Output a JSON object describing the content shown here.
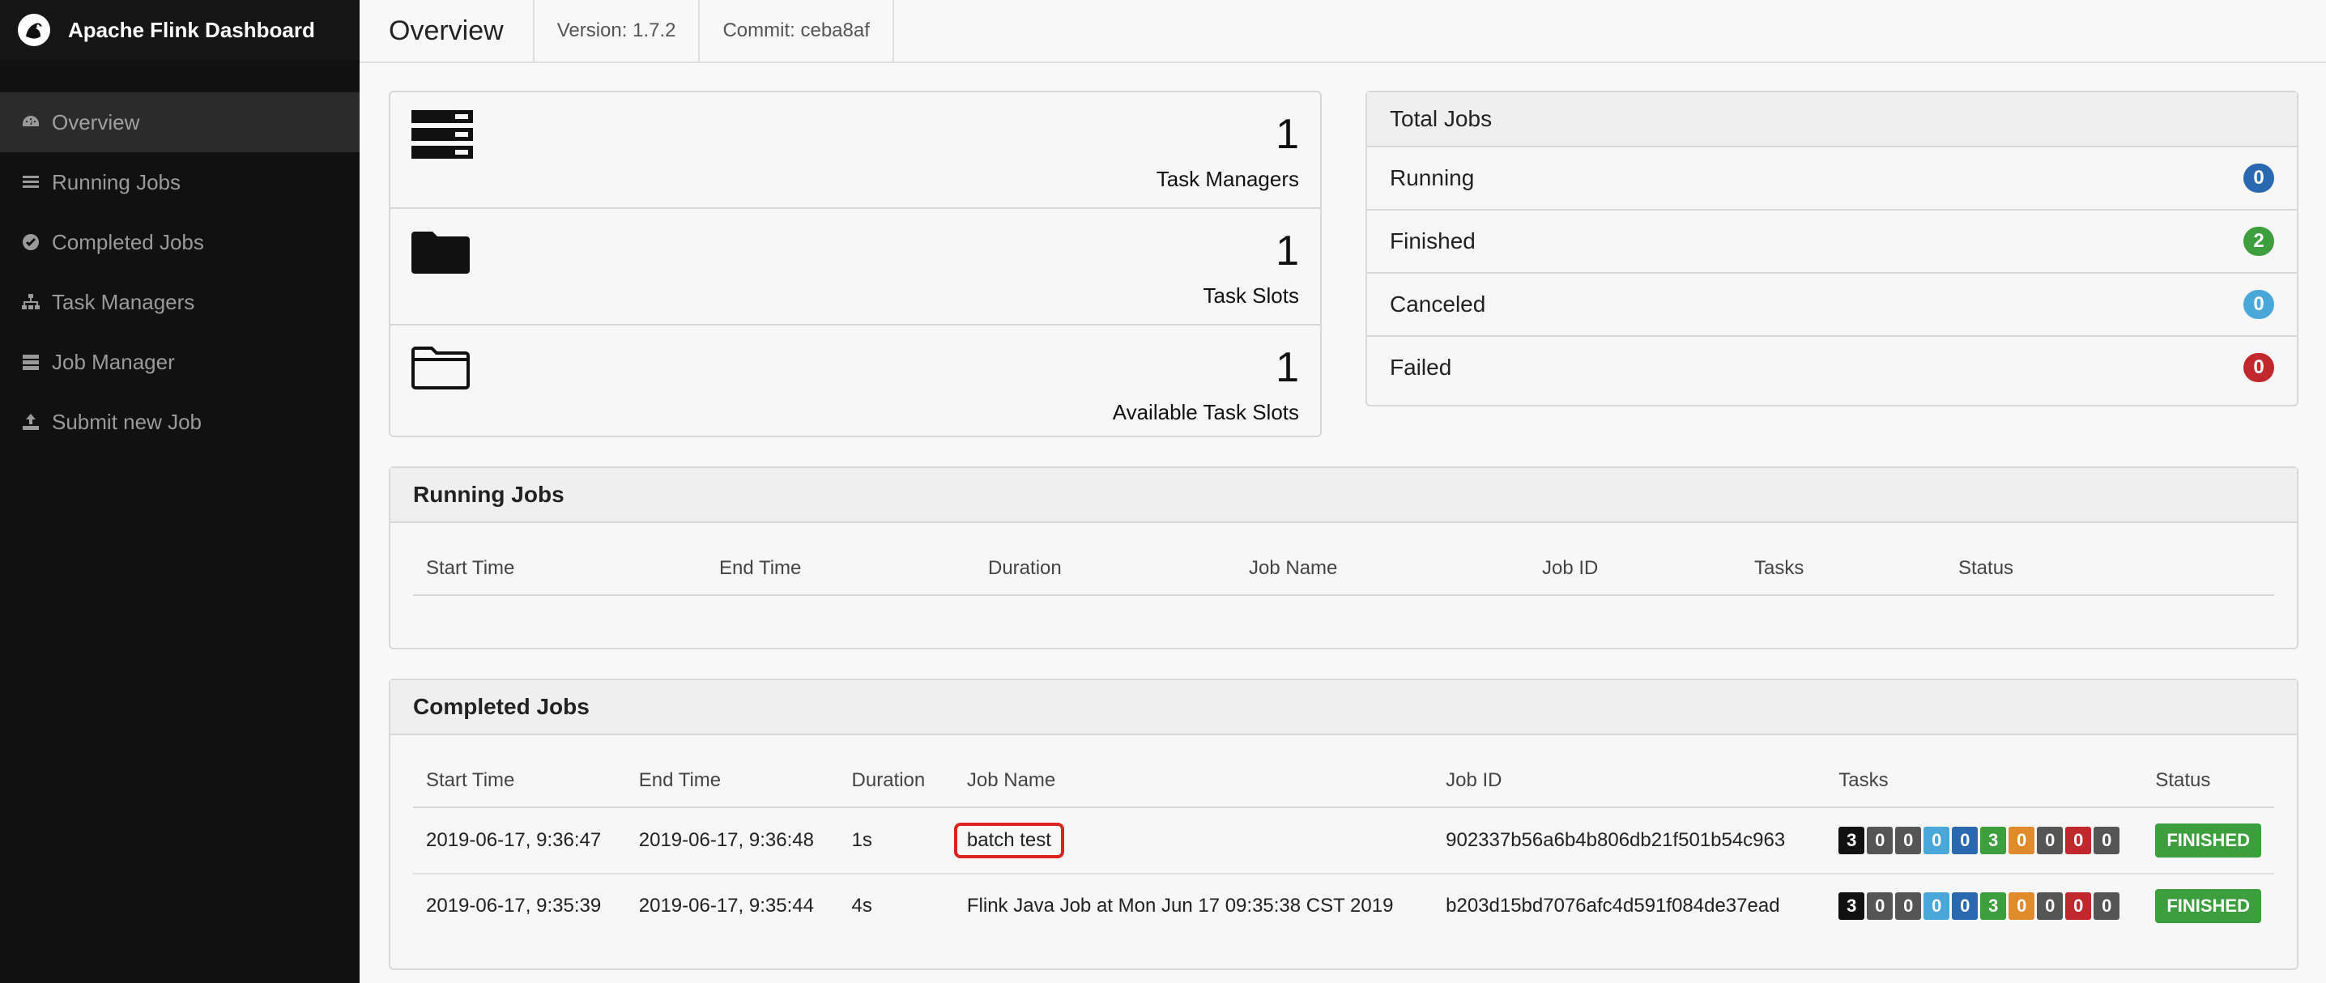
{
  "brand": {
    "title": "Apache Flink Dashboard"
  },
  "nav": [
    {
      "label": "Overview",
      "icon": "dashboard-icon",
      "active": true
    },
    {
      "label": "Running Jobs",
      "icon": "tasks-list-icon"
    },
    {
      "label": "Completed Jobs",
      "icon": "check-circle-icon"
    },
    {
      "label": "Task Managers",
      "icon": "sitemap-icon"
    },
    {
      "label": "Job Manager",
      "icon": "server-icon"
    },
    {
      "label": "Submit new Job",
      "icon": "upload-icon"
    }
  ],
  "header": {
    "title": "Overview",
    "version": "Version: 1.7.2",
    "commit": "Commit: ceba8af"
  },
  "stats": [
    {
      "value": "1",
      "label": "Task Managers",
      "icon": "server-stack-icon"
    },
    {
      "value": "1",
      "label": "Task Slots",
      "icon": "folder-icon"
    },
    {
      "value": "1",
      "label": "Available Task Slots",
      "icon": "folder-open-icon"
    }
  ],
  "totals": {
    "title": "Total Jobs",
    "rows": [
      {
        "label": "Running",
        "count": "0",
        "color": "#2a69b0"
      },
      {
        "label": "Finished",
        "count": "2",
        "color": "#3c9e3c"
      },
      {
        "label": "Canceled",
        "count": "0",
        "color": "#4aa8d8"
      },
      {
        "label": "Failed",
        "count": "0",
        "color": "#c0282d"
      }
    ]
  },
  "running": {
    "title": "Running Jobs",
    "columns": [
      "Start Time",
      "End Time",
      "Duration",
      "Job Name",
      "Job ID",
      "Tasks",
      "Status"
    ]
  },
  "completed": {
    "title": "Completed Jobs",
    "columns": [
      "Start Time",
      "End Time",
      "Duration",
      "Job Name",
      "Job ID",
      "Tasks",
      "Status"
    ],
    "rows": [
      {
        "start": "2019-06-17, 9:36:47",
        "end": "2019-06-17, 9:36:48",
        "duration": "1s",
        "name": "batch test",
        "id": "902337b56a6b4b806db21f501b54c963",
        "tasks": [
          "3",
          "0",
          "0",
          "0",
          "0",
          "3",
          "0",
          "0",
          "0",
          "0"
        ],
        "status": "FINISHED"
      },
      {
        "start": "2019-06-17, 9:35:39",
        "end": "2019-06-17, 9:35:44",
        "duration": "4s",
        "name": "Flink Java Job at Mon Jun 17 09:35:38 CST 2019",
        "id": "b203d15bd7076afc4d591f084de37ead",
        "tasks": [
          "3",
          "0",
          "0",
          "0",
          "0",
          "3",
          "0",
          "0",
          "0",
          "0"
        ],
        "status": "FINISHED"
      }
    ]
  },
  "task_colors": [
    "#111111",
    "#555555",
    "#555555",
    "#4aa8d8",
    "#2a69b0",
    "#3c9e3c",
    "#e08a2c",
    "#555555",
    "#c0282d",
    "#555555"
  ],
  "status_color": "#3c9e3c"
}
